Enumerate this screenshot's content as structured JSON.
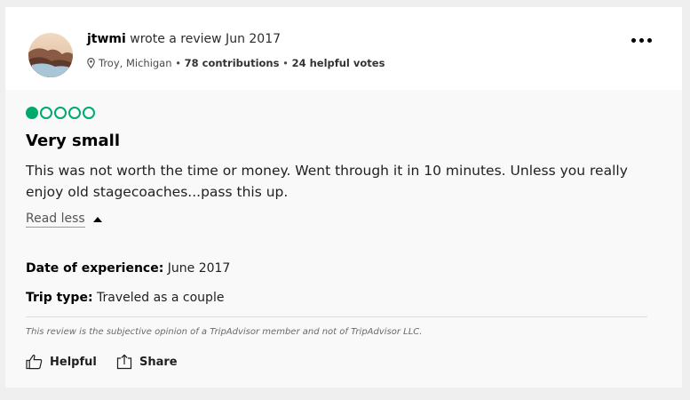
{
  "review": {
    "author": "jtwmi",
    "wrote_text": "wrote a review Jun 2017",
    "location": "Troy, Michigan",
    "separator": "•",
    "contributions": "78 contributions",
    "helpful_votes": "24 helpful votes",
    "rating": 1,
    "rating_max": 5,
    "rating_color": "#00aa6c",
    "title": "Very small",
    "text": "This was not worth the time or money. Went through it in 10 minutes. Unless you really enjoy old stagecoaches...pass this up.",
    "read_less_label": "Read less",
    "date_label": "Date of experience:",
    "date_value": "June 2017",
    "trip_label": "Trip type:",
    "trip_value": "Traveled as a couple",
    "disclaimer": "This review is the subjective opinion of a TripAdvisor member and not of TripAdvisor LLC."
  },
  "actions": {
    "helpful_label": "Helpful",
    "share_label": "Share"
  },
  "icons": {
    "more": "more-horizontal-icon",
    "location": "location-pin-icon",
    "caret": "caret-up-icon",
    "helpful": "thumbs-up-icon",
    "share": "share-icon"
  }
}
